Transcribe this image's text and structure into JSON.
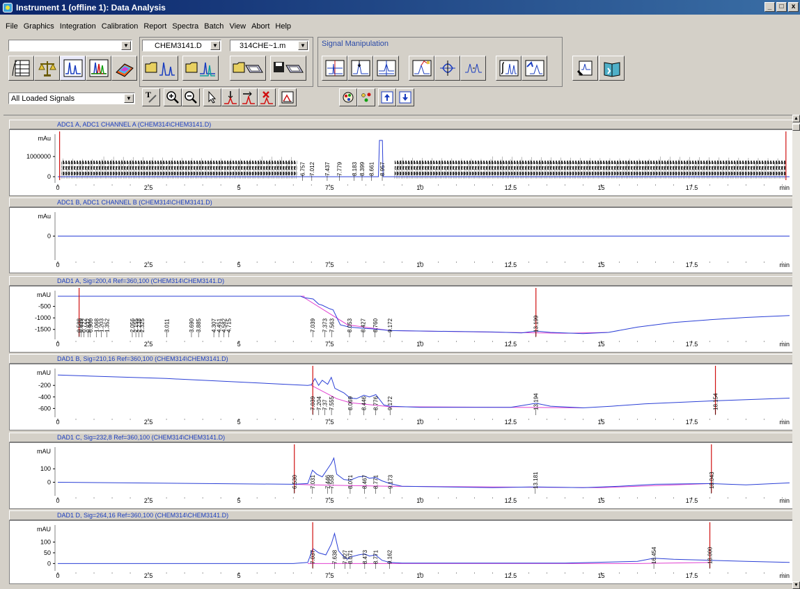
{
  "window": {
    "title": "Instrument 1 (offline 1): Data Analysis",
    "min": "_",
    "max": "□",
    "close": "x"
  },
  "menu": [
    "File",
    "Graphics",
    "Integration",
    "Calibration",
    "Report",
    "Spectra",
    "Batch",
    "View",
    "Abort",
    "Help"
  ],
  "toolbar": {
    "combo_empty": "",
    "file_combo": "CHEM3141.D",
    "method_combo": "314CHE~1.m",
    "signal_manipulation_label": "Signal Manipulation",
    "signal_combo": "All Loaded Signals"
  },
  "colors": {
    "trace": "#2a3fd6",
    "baseline": "#e040d0",
    "marker": "#d01010",
    "title_text": "#1a3dbf"
  },
  "x_axis": {
    "ticks": [
      "0",
      "2.5",
      "5",
      "7.5",
      "10",
      "12.5",
      "15",
      "17.5"
    ],
    "unit": "min",
    "range": [
      0,
      20.2
    ]
  },
  "panels": [
    {
      "id": "adc1a",
      "title": "ADC1 A, ADC1 CHANNEL A (CHEM314\\CHEM3141.D)",
      "y_ticks": [
        {
          "label": "mAu",
          "v": null
        },
        {
          "label": "1000000",
          "v": 1000000
        },
        {
          "label": "0",
          "v": 0
        }
      ],
      "y_range": [
        -100000,
        1900000
      ],
      "trace": [
        [
          0,
          0
        ],
        [
          8.85,
          0
        ],
        [
          8.88,
          1800000
        ],
        [
          8.96,
          1800000
        ],
        [
          8.98,
          0
        ],
        [
          20.2,
          0
        ]
      ],
      "peaks": [
        "6.757",
        "7.012",
        "7.437",
        "7.779",
        "8.183",
        "8.399",
        "8.661",
        "8.957"
      ],
      "peak_times": [
        6.757,
        7.012,
        7.437,
        7.779,
        8.183,
        8.399,
        8.661,
        8.957
      ],
      "noisy": true,
      "markers": [
        0.05,
        20.1
      ]
    },
    {
      "id": "adc1b",
      "title": "ADC1 B, ADC1 CHANNEL B (CHEM314\\CHEM3141.D)",
      "y_ticks": [
        {
          "label": "mAu",
          "v": null
        },
        {
          "label": "0",
          "v": 0
        }
      ],
      "y_range": [
        -1,
        1
      ],
      "trace": [
        [
          0,
          0
        ],
        [
          20.2,
          0
        ]
      ],
      "peaks": [],
      "peak_times": [],
      "markers": []
    },
    {
      "id": "dad1a",
      "title": "DAD1 A, Sig=200,4 Ref=360,100 (CHEM314\\CHEM3141.D)",
      "y_ticks": [
        {
          "label": "mAU",
          "v": null
        },
        {
          "label": "-500",
          "v": -500
        },
        {
          "label": "-1000",
          "v": -1000
        },
        {
          "label": "-1500",
          "v": -1500
        }
      ],
      "y_range": [
        -1750,
        0
      ],
      "trace": [
        [
          0,
          -60
        ],
        [
          6.7,
          -60
        ],
        [
          6.8,
          -120
        ],
        [
          7.05,
          -180
        ],
        [
          7.2,
          -400
        ],
        [
          7.3,
          -450
        ],
        [
          7.5,
          -600
        ],
        [
          7.6,
          -650
        ],
        [
          7.8,
          -1300
        ],
        [
          8.05,
          -1400
        ],
        [
          8.43,
          -1450
        ],
        [
          8.76,
          -1480
        ],
        [
          9.17,
          -1550
        ],
        [
          10,
          -1570
        ],
        [
          12,
          -1610
        ],
        [
          12.8,
          -1650
        ],
        [
          13.2,
          -1570
        ],
        [
          13.6,
          -1630
        ],
        [
          14.5,
          -1680
        ],
        [
          15.2,
          -1630
        ],
        [
          16,
          -1400
        ],
        [
          17,
          -1200
        ],
        [
          18,
          -1080
        ],
        [
          19,
          -980
        ],
        [
          20.2,
          -900
        ]
      ],
      "baseline": [
        [
          0,
          -60
        ],
        [
          6.8,
          -60
        ],
        [
          6.8,
          -120
        ],
        [
          8.0,
          -1300
        ],
        [
          9.17,
          -1550
        ],
        [
          14,
          -1670
        ],
        [
          15.2,
          -1630
        ]
      ],
      "peaks": [
        "0.588",
        "0.639",
        "0.722",
        "0.832",
        "0.900",
        "1.068",
        "1.203",
        "1.352",
        "2.056",
        "2.155",
        "2.238",
        "2.325",
        "3.011",
        "3.690",
        "3.885",
        "4.307",
        "4.451",
        "4.582",
        "4.715",
        "7.039",
        "7.373",
        "7.563",
        "8.053",
        "8.427",
        "8.760",
        "9.172",
        "13.199"
      ],
      "peak_times": [
        0.588,
        0.639,
        0.722,
        0.832,
        0.9,
        1.068,
        1.203,
        1.352,
        2.056,
        2.155,
        2.238,
        2.325,
        3.011,
        3.69,
        3.885,
        4.307,
        4.451,
        4.582,
        4.715,
        7.039,
        7.373,
        7.563,
        8.053,
        8.427,
        8.76,
        9.172,
        13.199
      ],
      "markers": [
        0.588,
        13.199
      ]
    },
    {
      "id": "dad1b",
      "title": "DAD1 B, Sig=210,16 Ref=360,100 (CHEM314\\CHEM3141.D)",
      "y_ticks": [
        {
          "label": "mAU",
          "v": null
        },
        {
          "label": "-200",
          "v": -200
        },
        {
          "label": "-400",
          "v": -400
        },
        {
          "label": "-600",
          "v": -600
        }
      ],
      "y_range": [
        -680,
        20
      ],
      "trace": [
        [
          0,
          -20
        ],
        [
          3,
          -80
        ],
        [
          6.9,
          -200
        ],
        [
          7.0,
          -190
        ],
        [
          7.1,
          -80
        ],
        [
          7.2,
          -200
        ],
        [
          7.3,
          -110
        ],
        [
          7.45,
          -180
        ],
        [
          7.55,
          -60
        ],
        [
          7.65,
          -250
        ],
        [
          7.9,
          -330
        ],
        [
          8.07,
          -420
        ],
        [
          8.25,
          -430
        ],
        [
          8.45,
          -370
        ],
        [
          8.6,
          -400
        ],
        [
          8.78,
          -360
        ],
        [
          9.0,
          -540
        ],
        [
          9.17,
          -560
        ],
        [
          10,
          -580
        ],
        [
          12.5,
          -580
        ],
        [
          13.0,
          -530
        ],
        [
          13.2,
          -510
        ],
        [
          13.6,
          -560
        ],
        [
          14.5,
          -590
        ],
        [
          15.3,
          -560
        ],
        [
          16.2,
          -520
        ],
        [
          18,
          -470
        ],
        [
          20.2,
          -420
        ]
      ],
      "baseline": [
        [
          7.0,
          -200
        ],
        [
          7.7,
          -430
        ],
        [
          8.07,
          -500
        ],
        [
          9.17,
          -570
        ],
        [
          12.5,
          -580
        ],
        [
          14.5,
          -590
        ]
      ],
      "peaks": [
        "7.039",
        "7.204",
        "7.37",
        "7.555",
        "8.069",
        "8.446",
        "8.776",
        "9.172",
        "13.194",
        "18.154"
      ],
      "peak_times": [
        7.039,
        7.204,
        7.37,
        7.555,
        8.069,
        8.446,
        8.776,
        9.172,
        13.194,
        18.154
      ],
      "markers": [
        7.039,
        18.154
      ]
    },
    {
      "id": "dad1c",
      "title": "DAD1 C, Sig=232,8 Ref=360,100 (CHEM314\\CHEM3141.D)",
      "y_ticks": [
        {
          "label": "mAU",
          "v": null
        },
        {
          "label": "100",
          "v": 100
        },
        {
          "label": "0",
          "v": 0
        }
      ],
      "y_range": [
        -70,
        230
      ],
      "trace": [
        [
          0,
          0
        ],
        [
          6.5,
          -15
        ],
        [
          6.9,
          -10
        ],
        [
          7.03,
          90
        ],
        [
          7.15,
          60
        ],
        [
          7.3,
          40
        ],
        [
          7.45,
          100
        ],
        [
          7.55,
          140
        ],
        [
          7.62,
          180
        ],
        [
          7.7,
          60
        ],
        [
          7.9,
          20
        ],
        [
          8.07,
          15
        ],
        [
          8.3,
          40
        ],
        [
          8.47,
          45
        ],
        [
          8.6,
          30
        ],
        [
          8.77,
          35
        ],
        [
          8.95,
          10
        ],
        [
          9.17,
          -10
        ],
        [
          9.5,
          -30
        ],
        [
          12,
          -40
        ],
        [
          13.2,
          -35
        ],
        [
          14.5,
          -40
        ],
        [
          15.5,
          -30
        ],
        [
          16.5,
          -15
        ],
        [
          18,
          -10
        ],
        [
          19,
          -20
        ],
        [
          20.2,
          -5
        ]
      ],
      "baseline": [
        [
          6.53,
          -15
        ],
        [
          7.0,
          -20
        ],
        [
          9.17,
          -30
        ],
        [
          15,
          -40
        ],
        [
          18,
          -10
        ]
      ],
      "peaks": [
        "6.530",
        "7.031",
        "7.446",
        "7.558",
        "8.071",
        "8.467",
        "8.771",
        "9.173",
        "13.181",
        "18.043"
      ],
      "peak_times": [
        6.53,
        7.031,
        7.446,
        7.558,
        8.071,
        8.467,
        8.771,
        9.173,
        13.181,
        18.043
      ],
      "markers": [
        6.53,
        18.043
      ]
    },
    {
      "id": "dad1d",
      "title": "DAD1 D, Sig=264,16 Ref=360,100 (CHEM314\\CHEM3141.D)",
      "y_ticks": [
        {
          "label": "mAU",
          "v": null
        },
        {
          "label": "100",
          "v": 100
        },
        {
          "label": "50",
          "v": 50
        },
        {
          "label": "0",
          "v": 0
        }
      ],
      "y_range": [
        -15,
        160
      ],
      "trace": [
        [
          0,
          0
        ],
        [
          6.5,
          0
        ],
        [
          6.9,
          5
        ],
        [
          7.04,
          70
        ],
        [
          7.2,
          50
        ],
        [
          7.4,
          40
        ],
        [
          7.55,
          90
        ],
        [
          7.64,
          140
        ],
        [
          7.75,
          60
        ],
        [
          7.9,
          30
        ],
        [
          8.0,
          20
        ],
        [
          8.07,
          30
        ],
        [
          8.3,
          40
        ],
        [
          8.47,
          45
        ],
        [
          8.6,
          35
        ],
        [
          8.77,
          40
        ],
        [
          8.95,
          15
        ],
        [
          9.16,
          5
        ],
        [
          9.5,
          2
        ],
        [
          14,
          2
        ],
        [
          16,
          10
        ],
        [
          16.45,
          25
        ],
        [
          17,
          20
        ],
        [
          18,
          15
        ],
        [
          19,
          10
        ],
        [
          20.2,
          5
        ]
      ],
      "baseline": [
        [
          6.9,
          0
        ],
        [
          9.16,
          0
        ],
        [
          16,
          0
        ],
        [
          18,
          5
        ]
      ],
      "peaks": [
        "7.037",
        "7.638",
        "7.927",
        "8.071",
        "8.473",
        "8.771",
        "9.162",
        "16.454",
        "18.000"
      ],
      "peak_times": [
        7.037,
        7.638,
        7.927,
        8.071,
        8.473,
        8.771,
        9.162,
        16.454,
        18.0
      ],
      "markers": [
        7.037,
        18.0
      ]
    }
  ]
}
